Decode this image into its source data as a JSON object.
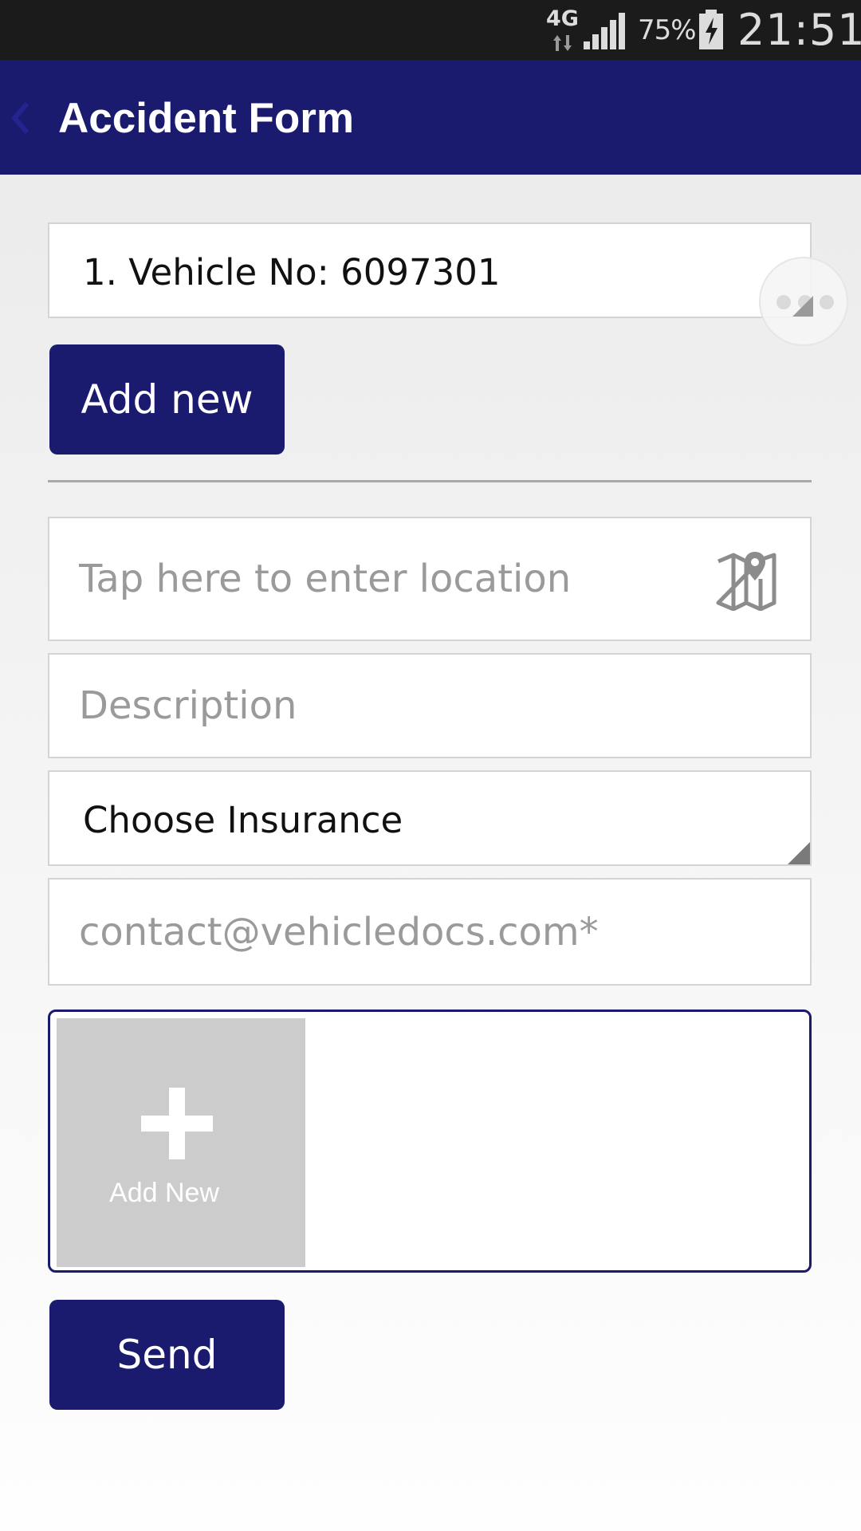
{
  "status_bar": {
    "network_type": "4G",
    "battery_percent": "75%",
    "time": "21:51"
  },
  "app_bar": {
    "title": "Accident Form",
    "back_icon": "chevron-left-icon",
    "background_color": "#1a1a6e"
  },
  "form": {
    "vehicle_selected": "1. Vehicle No: 6097301",
    "add_new_label": "Add new",
    "location_placeholder": "Tap here to enter location",
    "location_icon": "map-pin-icon",
    "description_placeholder": "Description",
    "insurance_selected": "Choose Insurance",
    "email_placeholder": "contact@vehicledocs.com*",
    "photo_add_label": "Add New",
    "send_label": "Send"
  },
  "overlay": {
    "floating_menu_icon": "more-dots-icon"
  },
  "colors": {
    "primary": "#1a1a6e",
    "status_bar": "#1b1b1b",
    "placeholder": "#9a9a9a"
  }
}
